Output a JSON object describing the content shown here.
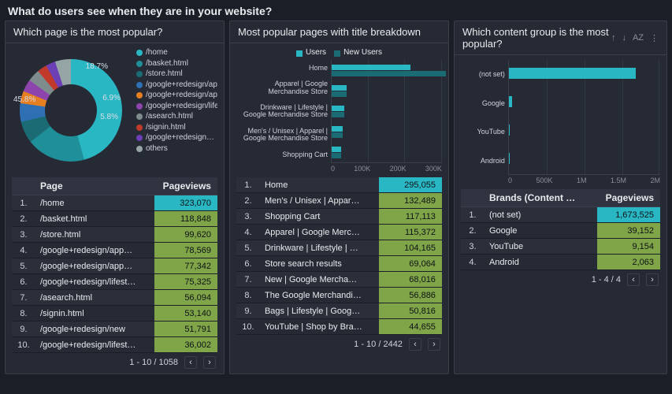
{
  "page_title": "What do users see when they are in your website?",
  "panels": {
    "donut": {
      "title": "Which page is the most popular?",
      "table": {
        "col1": "Page",
        "col2": "Pageviews",
        "pager": "1 - 10 / 1058"
      },
      "pct_big": "45.8%",
      "pct_187": "18.7%",
      "pct_69": "6.9%",
      "pct_58": "5.8%",
      "legend": [
        {
          "c": "#2ab7c4",
          "t": "/home"
        },
        {
          "c": "#1f8f9a",
          "t": "/basket.html"
        },
        {
          "c": "#1a6b73",
          "t": "/store.html"
        },
        {
          "c": "#2f6fb3",
          "t": "/google+redesign/apparel/mens"
        },
        {
          "c": "#e67e22",
          "t": "/google+redesign/apparel"
        },
        {
          "c": "#8e44ad",
          "t": "/google+redesign/lifestyle/drinkware"
        },
        {
          "c": "#7f8c8d",
          "t": "/asearch.html"
        },
        {
          "c": "#c0392b",
          "t": "/signin.html"
        },
        {
          "c": "#6c3fb5",
          "t": "/google+redesign…"
        },
        {
          "c": "#95a5a6",
          "t": "others"
        }
      ],
      "rows": [
        {
          "n": "1.",
          "p": "/home",
          "v": "323,070",
          "hl": true
        },
        {
          "n": "2.",
          "p": "/basket.html",
          "v": "118,848"
        },
        {
          "n": "3.",
          "p": "/store.html",
          "v": "99,620"
        },
        {
          "n": "4.",
          "p": "/google+redesign/app…",
          "v": "78,569"
        },
        {
          "n": "5.",
          "p": "/google+redesign/app…",
          "v": "77,342"
        },
        {
          "n": "6.",
          "p": "/google+redesign/lifest…",
          "v": "75,325"
        },
        {
          "n": "7.",
          "p": "/asearch.html",
          "v": "56,094"
        },
        {
          "n": "8.",
          "p": "/signin.html",
          "v": "53,140"
        },
        {
          "n": "9.",
          "p": "/google+redesign/new",
          "v": "51,791"
        },
        {
          "n": "10.",
          "p": "/google+redesign/lifest…",
          "v": "36,002"
        }
      ]
    },
    "bars": {
      "title": "Most popular pages with title breakdown",
      "table": {
        "pager": "1 - 10 / 2442"
      },
      "legend_users": "Users",
      "legend_new": "New Users",
      "axis": [
        "0",
        "100K",
        "200K",
        "300K"
      ],
      "cats": [
        "Home",
        "Apparel | Google Merchandise Store",
        "Drinkware | Lifestyle | Google Merchandise Store",
        "Men's / Unisex | Apparel | Google Merchandise Store",
        "Shopping Cart"
      ],
      "rows": [
        {
          "n": "1.",
          "p": "Home",
          "v": "295,055",
          "hl": true
        },
        {
          "n": "2.",
          "p": "Men's / Unisex | Appar…",
          "v": "132,489"
        },
        {
          "n": "3.",
          "p": "Shopping Cart",
          "v": "117,113"
        },
        {
          "n": "4.",
          "p": "Apparel | Google Merc…",
          "v": "115,372"
        },
        {
          "n": "5.",
          "p": "Drinkware | Lifestyle | …",
          "v": "104,165"
        },
        {
          "n": "6.",
          "p": "Store search results",
          "v": "69,064"
        },
        {
          "n": "7.",
          "p": "New | Google Mercha…",
          "v": "68,016"
        },
        {
          "n": "8.",
          "p": "The Google Merchandi…",
          "v": "56,886"
        },
        {
          "n": "9.",
          "p": "Bags | Lifestyle | Goog…",
          "v": "50,816"
        },
        {
          "n": "10.",
          "p": "YouTube | Shop by Bra…",
          "v": "44,655"
        }
      ]
    },
    "brands": {
      "title": "Which content group is the most popular?",
      "table": {
        "col1": "Brands (Content …",
        "col2": "Pageviews",
        "pager": "1 - 4 / 4"
      },
      "axis": [
        "0",
        "500K",
        "1M",
        "1.5M",
        "2M"
      ],
      "cats": [
        "(not set)",
        "Google",
        "YouTube",
        "Android"
      ],
      "rows": [
        {
          "n": "1.",
          "p": "(not set)",
          "v": "1,673,525",
          "hl": true
        },
        {
          "n": "2.",
          "p": "Google",
          "v": "39,152"
        },
        {
          "n": "3.",
          "p": "YouTube",
          "v": "9,154"
        },
        {
          "n": "4.",
          "p": "Android",
          "v": "2,063"
        }
      ]
    }
  },
  "chart_data": [
    {
      "type": "pie",
      "title": "Which page is the most popular?",
      "series": [
        {
          "name": "/home",
          "value": 45.8
        },
        {
          "name": "/basket.html",
          "value": 18.7
        },
        {
          "name": "/store.html",
          "value": 6.9
        },
        {
          "name": "/google+redesign/apparel/mens",
          "value": 5.8
        },
        {
          "name": "/google+redesign/apparel",
          "value": 4
        },
        {
          "name": "/google+redesign/lifestyle/drinkware",
          "value": 4
        },
        {
          "name": "/asearch.html",
          "value": 4
        },
        {
          "name": "/signin.html",
          "value": 3
        },
        {
          "name": "/google+redesign…",
          "value": 3
        },
        {
          "name": "others",
          "value": 4.8
        }
      ]
    },
    {
      "type": "bar",
      "title": "Most popular pages with title breakdown",
      "orientation": "horizontal",
      "categories": [
        "Home",
        "Apparel | Google Merchandise Store",
        "Drinkware | Lifestyle | Google Merchandise Store",
        "Men's / Unisex | Apparel | Google Merchandise Store",
        "Shopping Cart"
      ],
      "series": [
        {
          "name": "Users",
          "values": [
            215000,
            40000,
            35000,
            30000,
            25000
          ]
        },
        {
          "name": "New Users",
          "values": [
            310000,
            40000,
            35000,
            30000,
            25000
          ]
        }
      ],
      "xlabel": "",
      "ylabel": "",
      "xlim": [
        0,
        300000
      ],
      "xticks": [
        0,
        100000,
        200000,
        300000
      ]
    },
    {
      "type": "bar",
      "title": "Which content group is the most popular?",
      "orientation": "horizontal",
      "categories": [
        "(not set)",
        "Google",
        "YouTube",
        "Android"
      ],
      "values": [
        1673525,
        39152,
        9154,
        2063
      ],
      "xlim": [
        0,
        2000000
      ],
      "xticks": [
        0,
        500000,
        1000000,
        1500000,
        2000000
      ]
    }
  ]
}
